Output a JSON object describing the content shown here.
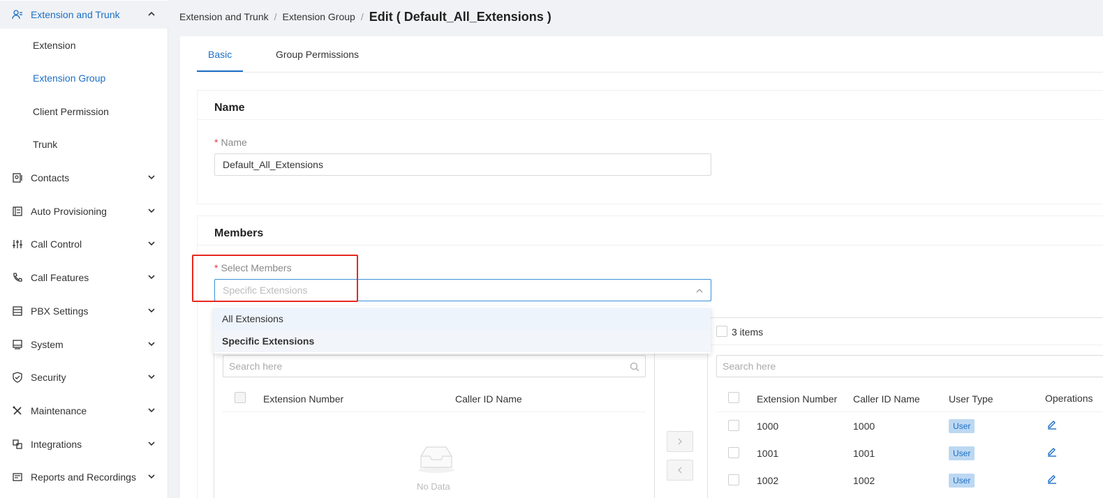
{
  "sidebar": {
    "items": [
      {
        "label": "Extension and Trunk",
        "icon": "users-icon",
        "expanded": true
      },
      {
        "label": "Contacts",
        "icon": "contacts-icon"
      },
      {
        "label": "Auto Provisioning",
        "icon": "provisioning-icon"
      },
      {
        "label": "Call Control",
        "icon": "sliders-icon"
      },
      {
        "label": "Call Features",
        "icon": "phone-icon"
      },
      {
        "label": "PBX Settings",
        "icon": "server-icon"
      },
      {
        "label": "System",
        "icon": "monitor-icon"
      },
      {
        "label": "Security",
        "icon": "shield-icon"
      },
      {
        "label": "Maintenance",
        "icon": "tools-icon"
      },
      {
        "label": "Integrations",
        "icon": "integrations-icon"
      },
      {
        "label": "Reports and Recordings",
        "icon": "reports-icon"
      }
    ],
    "sub_items": [
      {
        "label": "Extension"
      },
      {
        "label": "Extension Group",
        "active": true
      },
      {
        "label": "Client Permission"
      },
      {
        "label": "Trunk"
      }
    ]
  },
  "breadcrumb": {
    "items": [
      "Extension and Trunk",
      "Extension Group"
    ],
    "separator": "/",
    "current": "Edit ( Default_All_Extensions )"
  },
  "tabs": [
    {
      "label": "Basic",
      "active": true
    },
    {
      "label": "Group Permissions"
    }
  ],
  "name_section": {
    "title": "Name",
    "required_mark": "*",
    "label": "Name",
    "value": "Default_All_Extensions"
  },
  "members_section": {
    "title": "Members",
    "required_mark": "*",
    "label": "Select Members",
    "placeholder": "Specific Extensions",
    "options": [
      "All Extensions",
      "Specific Extensions"
    ],
    "selected_option": "Specific Extensions"
  },
  "transfer": {
    "left": {
      "search_placeholder": "Search here",
      "columns": [
        "Extension Number",
        "Caller ID Name"
      ],
      "empty_text": "No Data"
    },
    "right": {
      "count_label": "3 items",
      "search_placeholder": "Search here",
      "columns": [
        "Extension Number",
        "Caller ID Name",
        "User Type",
        "Operations"
      ],
      "rows": [
        {
          "ext": "1000",
          "caller_id": "1000",
          "user_type": "User"
        },
        {
          "ext": "1001",
          "caller_id": "1001",
          "user_type": "User"
        },
        {
          "ext": "1002",
          "caller_id": "1002",
          "user_type": "User"
        }
      ]
    }
  },
  "colors": {
    "accent": "#1c6fc8",
    "highlight": "#e8281f",
    "badge_bg": "#bcd8f2"
  }
}
